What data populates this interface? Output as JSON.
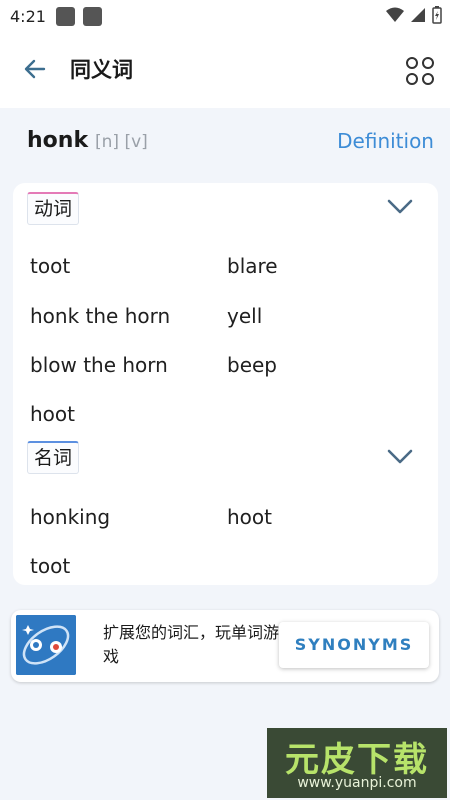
{
  "status_bar": {
    "time": "4:21"
  },
  "app_bar": {
    "title": "同义词"
  },
  "word": {
    "text": "honk",
    "pos_tags": "[n] [v]",
    "definition_link": "Definition"
  },
  "sections": {
    "verb": {
      "label": "动词",
      "synonyms": [
        "toot",
        "blare",
        "honk the horn",
        "yell",
        "blow the horn",
        "beep",
        "hoot"
      ]
    },
    "noun": {
      "label": "名词",
      "synonyms": [
        "honking",
        "hoot",
        "toot"
      ]
    }
  },
  "ad": {
    "text": "扩展您的词汇，玩单词游戏",
    "button": "SYNONYMS"
  },
  "watermark": {
    "title": "元皮下载",
    "url": "www.yuanpi.com"
  },
  "colors": {
    "accent": "#3d8cd6",
    "verb_tab": "#e47ab7",
    "noun_tab": "#5b8fe0",
    "background": "#f2f5fa"
  }
}
